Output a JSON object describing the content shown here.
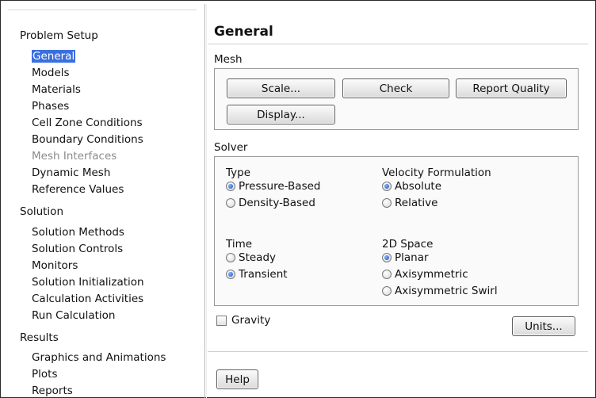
{
  "tree": {
    "problem_setup": "Problem Setup",
    "problem_items": [
      "General",
      "Models",
      "Materials",
      "Phases",
      "Cell Zone Conditions",
      "Boundary Conditions",
      "Mesh Interfaces",
      "Dynamic Mesh",
      "Reference Values"
    ],
    "solution": "Solution",
    "solution_items": [
      "Solution Methods",
      "Solution Controls",
      "Monitors",
      "Solution Initialization",
      "Calculation Activities",
      "Run Calculation"
    ],
    "results": "Results",
    "results_items": [
      "Graphics and Animations",
      "Plots",
      "Reports"
    ]
  },
  "panel": {
    "title": "General",
    "mesh": {
      "label": "Mesh",
      "scale": "Scale...",
      "check": "Check",
      "report_quality": "Report Quality",
      "display": "Display..."
    },
    "solver": {
      "label": "Solver",
      "type_label": "Type",
      "pressure_based": "Pressure-Based",
      "density_based": "Density-Based",
      "velocity_label": "Velocity Formulation",
      "absolute": "Absolute",
      "relative": "Relative",
      "time_label": "Time",
      "steady": "Steady",
      "transient": "Transient",
      "space_label": "2D Space",
      "planar": "Planar",
      "axisymmetric": "Axisymmetric",
      "axisymmetric_swirl": "Axisymmetric Swirl",
      "selected": {
        "type": "Pressure-Based",
        "velocity": "Absolute",
        "time": "Transient",
        "space": "Planar"
      }
    },
    "gravity": "Gravity",
    "gravity_checked": false,
    "units": "Units...",
    "help": "Help"
  },
  "colors": {
    "selection": "#3a6fe0",
    "disabled_text": "#8a8a8a"
  }
}
